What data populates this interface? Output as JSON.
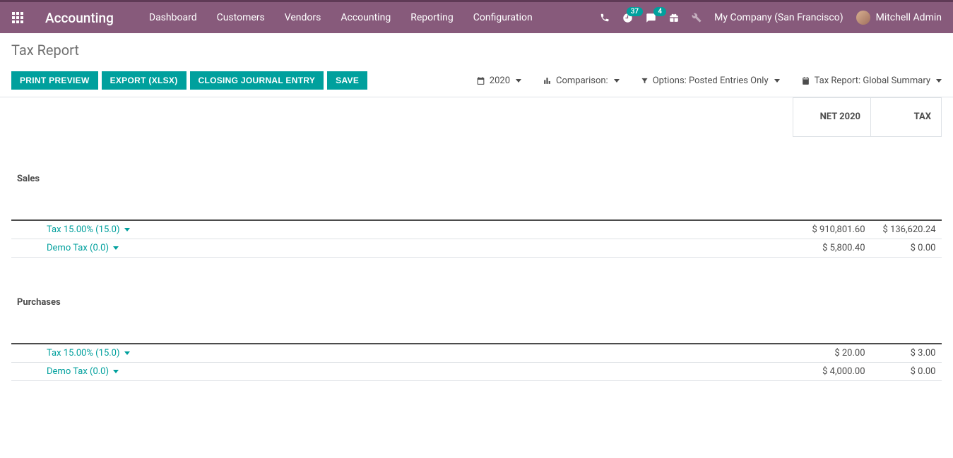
{
  "brand": "Accounting",
  "nav": {
    "dashboard": "Dashboard",
    "customers": "Customers",
    "vendors": "Vendors",
    "accounting": "Accounting",
    "reporting": "Reporting",
    "configuration": "Configuration"
  },
  "badges": {
    "activities": "37",
    "messages": "4"
  },
  "company": "My Company (San Francisco)",
  "user": "Mitchell Admin",
  "page_title": "Tax Report",
  "buttons": {
    "print_preview": "PRINT PREVIEW",
    "export_xlsx": "EXPORT (XLSX)",
    "closing_entry": "CLOSING JOURNAL ENTRY",
    "save": "SAVE"
  },
  "filters": {
    "period": "2020",
    "comparison_label": "Comparison:",
    "options_label": "Options: Posted Entries Only",
    "tax_report_label": "Tax Report: Global Summary"
  },
  "columns": {
    "net": "NET 2020",
    "tax": "TAX"
  },
  "sections": [
    {
      "title": "Sales",
      "rows": [
        {
          "label": "Tax 15.00% (15.0)",
          "net": "$ 910,801.60",
          "tax": "$ 136,620.24"
        },
        {
          "label": "Demo Tax (0.0)",
          "net": "$ 5,800.40",
          "tax": "$ 0.00"
        }
      ]
    },
    {
      "title": "Purchases",
      "rows": [
        {
          "label": "Tax 15.00% (15.0)",
          "net": "$ 20.00",
          "tax": "$ 3.00"
        },
        {
          "label": "Demo Tax (0.0)",
          "net": "$ 4,000.00",
          "tax": "$ 0.00"
        }
      ]
    }
  ]
}
